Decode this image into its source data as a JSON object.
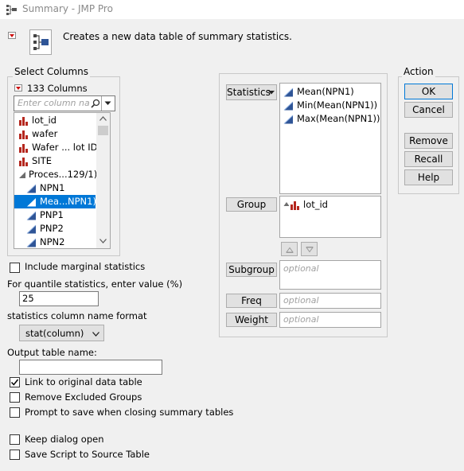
{
  "window": {
    "title": "Summary - JMP Pro"
  },
  "header": {
    "description": "Creates a new data table of summary statistics."
  },
  "select_columns": {
    "legend": "Select Columns",
    "count_label": "133 Columns",
    "search_placeholder": "Enter column na",
    "items": [
      {
        "label": "lot_id",
        "icon": "nominal-bar-icon"
      },
      {
        "label": "wafer",
        "icon": "nominal-bar-icon"
      },
      {
        "label": "Wafer ... lot ID",
        "icon": "nominal-bar-icon"
      },
      {
        "label": "SITE",
        "icon": "nominal-bar-icon"
      },
      {
        "label": "Proces...129/1)",
        "icon": "group-expand-icon"
      },
      {
        "label": "NPN1",
        "icon": "continuous-triangle-icon"
      },
      {
        "label": "Mea...NPN1)",
        "icon": "continuous-triangle-icon",
        "selected": true
      },
      {
        "label": "PNP1",
        "icon": "continuous-triangle-icon"
      },
      {
        "label": "PNP2",
        "icon": "continuous-triangle-icon"
      },
      {
        "label": "NPN2",
        "icon": "continuous-triangle-icon"
      }
    ]
  },
  "options": {
    "include_marginal": "Include marginal statistics",
    "quantile_label": "For quantile statistics, enter value (%)",
    "quantile_value": "25",
    "name_format_label": "statistics column name format",
    "name_format_value": "stat(column)",
    "output_name_label": "Output table name:",
    "output_name_value": "",
    "link_original": "Link to original data table",
    "remove_excluded": "Remove Excluded Groups",
    "prompt_save": "Prompt to save when closing summary tables",
    "keep_open": "Keep dialog open",
    "save_script": "Save Script to Source Table"
  },
  "roles": {
    "statistics_button": "Statistics",
    "statistics_items": [
      "Mean(NPN1)",
      "Min(Mean(NPN1))",
      "Max(Mean(NPN1))"
    ],
    "group_button": "Group",
    "group_items": [
      "lot_id"
    ],
    "subgroup_button": "Subgroup",
    "freq_button": "Freq",
    "weight_button": "Weight",
    "optional_placeholder": "optional"
  },
  "action": {
    "legend": "Action",
    "ok": "OK",
    "cancel": "Cancel",
    "remove": "Remove",
    "recall": "Recall",
    "help": "Help"
  },
  "colors": {
    "nominal": "#b5271e",
    "continuous": "#2f5597",
    "selection": "#0078d7"
  }
}
